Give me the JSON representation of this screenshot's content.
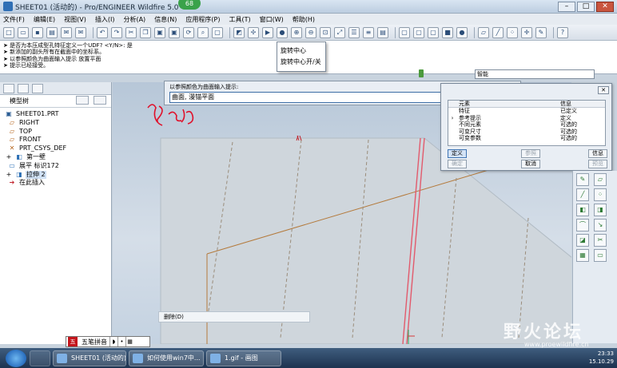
{
  "window": {
    "title": "SHEET01 (活动的) - Pro/ENGINEER Wildfire 5.0",
    "badge": "68"
  },
  "menu": [
    "文件(F)",
    "编辑(E)",
    "视图(V)",
    "插入(I)",
    "分析(A)",
    "信息(N)",
    "应用程序(P)",
    "工具(T)",
    "窗口(W)",
    "帮助(H)"
  ],
  "messages": [
    "➤ 是否为本压成型孔特征定义一个UDF? <Y/N>:  是",
    "➤ 新添加的副头所有在截面中的坐标系。",
    "➤ 以参照颜色为曲面输入提示   放置平面",
    "➤ 提示已经接受。"
  ],
  "popup_menu": [
    "旋转中心",
    "旋转中心开/关"
  ],
  "filter": {
    "value": "智能"
  },
  "navigator": {
    "title": "模型树",
    "items": [
      {
        "icon": "part-icon",
        "label": "SHEET01.PRT"
      },
      {
        "icon": "datum-plane-icon",
        "label": "RIGHT"
      },
      {
        "icon": "datum-plane-icon",
        "label": "TOP"
      },
      {
        "icon": "datum-plane-icon",
        "label": "FRONT"
      },
      {
        "icon": "csys-icon",
        "label": "PRT_CSYS_DEF"
      },
      {
        "icon": "wall-icon",
        "label": "第一壁"
      },
      {
        "icon": "flat-icon",
        "label": "展平 标识172"
      },
      {
        "icon": "extrude-icon",
        "label": "拉伸 2"
      },
      {
        "icon": "insert-here-icon",
        "label": "在此插入"
      }
    ]
  },
  "prompt": {
    "label": "以参照颜色为曲面输入提示:",
    "value": "曲面, 漫锚平面"
  },
  "dialog": {
    "columns": [
      "元素",
      "信息"
    ],
    "rows": [
      {
        "element": "特征",
        "info": "已定义"
      },
      {
        "element": "参考提示",
        "info": "定义"
      },
      {
        "element": "不同元素",
        "info": "可选的"
      },
      {
        "element": "可变尺寸",
        "info": "可选的"
      },
      {
        "element": "可变参数",
        "info": "可选的"
      }
    ],
    "buttons": {
      "define": "定义",
      "reference": "参照",
      "info": "信息",
      "confirm": "确定",
      "cancel": "取消",
      "preview": "预览"
    }
  },
  "annotation": {
    "handwriting": "参条的"
  },
  "context_bar": {
    "delete_label": "删除(D)"
  },
  "ime": {
    "label": "五笔拼音"
  },
  "watermark": {
    "text": "野火论坛",
    "url": "www.proewildfire.cn"
  },
  "taskbar": {
    "items": [
      "SHEET01 (活动的)...",
      "如何使用win7中...",
      "1.gif - 画图"
    ],
    "time": "23:33",
    "date": "15.10.29"
  },
  "colors": {
    "accent": "#3d6ea6",
    "handwriting": "#e0102a",
    "extrude_edge": "#e25a6c"
  }
}
